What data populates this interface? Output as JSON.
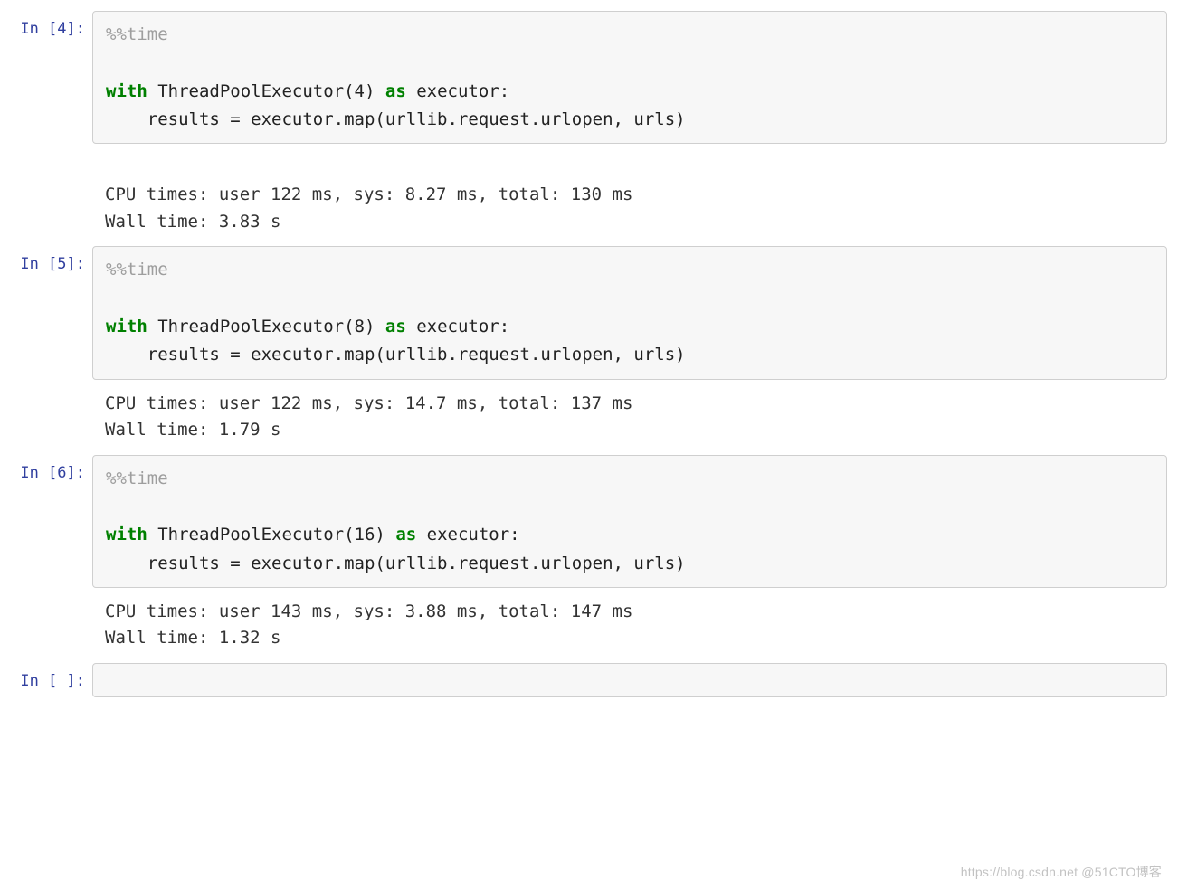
{
  "cells": [
    {
      "prompt": "In [4]:",
      "magic": "%%time",
      "kw_with": "with",
      "fn": " ThreadPoolExecutor(4) ",
      "kw_as": "as",
      "rest": " executor:",
      "line2": "    results = executor.map(urllib.request.urlopen, urls)",
      "out1": "CPU times: user 122 ms, sys: 8.27 ms, total: 130 ms",
      "out2": "Wall time: 3.83 s"
    },
    {
      "prompt": "In [5]:",
      "magic": "%%time",
      "kw_with": "with",
      "fn": " ThreadPoolExecutor(8) ",
      "kw_as": "as",
      "rest": " executor:",
      "line2": "    results = executor.map(urllib.request.urlopen, urls)",
      "out1": "CPU times: user 122 ms, sys: 14.7 ms, total: 137 ms",
      "out2": "Wall time: 1.79 s"
    },
    {
      "prompt": "In [6]:",
      "magic": "%%time",
      "kw_with": "with",
      "fn": " ThreadPoolExecutor(16) ",
      "kw_as": "as",
      "rest": " executor:",
      "line2": "    results = executor.map(urllib.request.urlopen, urls)",
      "out1": "CPU times: user 143 ms, sys: 3.88 ms, total: 147 ms",
      "out2": "Wall time: 1.32 s"
    }
  ],
  "empty_prompt": "In [ ]:",
  "watermark": "https://blog.csdn.net @51CTO博客"
}
